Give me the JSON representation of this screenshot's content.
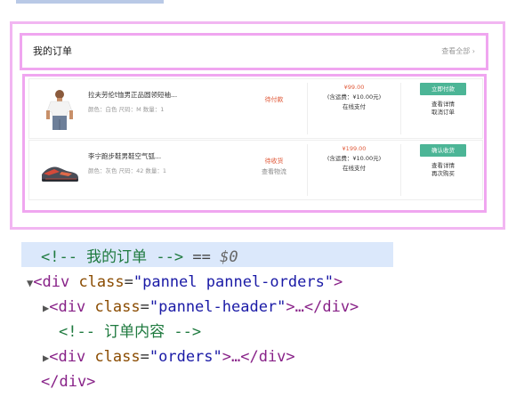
{
  "panel": {
    "title": "我的订单",
    "view_all": "查看全部 ›"
  },
  "orders": [
    {
      "name": "拉夫劳伦t恤男正品圆领短袖...",
      "meta": "颜色：白色  尺码：M  数量：1",
      "status": "待付款",
      "status_sub": "",
      "price": "¥99.00",
      "shipping": "(含运费：¥10.00元)",
      "pay": "在线支付",
      "primary": "立即付款",
      "op1": "查看详情",
      "op2": "取消订单",
      "thumb_icon": "tshirt-man-icon"
    },
    {
      "name": "李宁跑步鞋男鞋空气弧...",
      "meta": "颜色：灰色  尺码：42  数量：1",
      "status": "待收货",
      "status_sub": "查看物流",
      "price": "¥199.00",
      "shipping": "(含运费：¥10.00元)",
      "pay": "在线支付",
      "primary": "确认收货",
      "op1": "查看详情",
      "op2": "再次购买",
      "thumb_icon": "sneaker-icon"
    }
  ],
  "devtools": {
    "line1_comment": "<!-- 我的订单 -->",
    "line1_eq": "==",
    "line1_var": "$0",
    "line2_tag_open": "<div",
    "line2_attr": "class",
    "line2_val": "\"pannel pannel-orders\"",
    "line2_close": ">",
    "line3_tag_open": "<div",
    "line3_attr": "class",
    "line3_val": "\"pannel-header\"",
    "line3_rest": ">…</div>",
    "line4_comment": "<!-- 订单内容 -->",
    "line5_tag_open": "<div",
    "line5_attr": "class",
    "line5_val": "\"orders\"",
    "line5_rest": ">…</div>",
    "line6_close": "</div>"
  },
  "colors": {
    "highlight": "#f0a6f0",
    "accent_green": "#4cb596",
    "price_red": "#e05a3a",
    "selection": "#dbe8fb"
  }
}
